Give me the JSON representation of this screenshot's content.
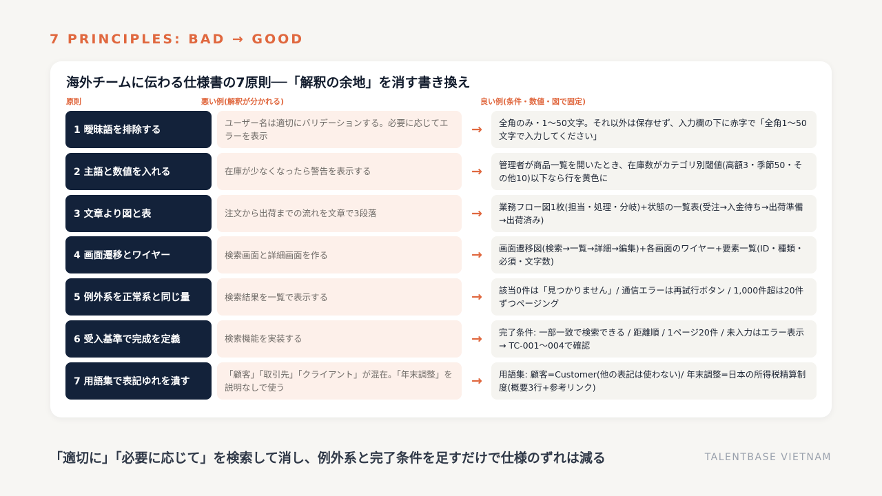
{
  "eyebrow": "7 PRINCIPLES: BAD → GOOD",
  "card": {
    "title": "海外チームに伝わる仕様書の7原則──「解釈の余地」を消す書き換え",
    "col_principle": "原則",
    "col_bad": "悪い例(解釈が分かれる)",
    "col_good": "良い例(条件・数値・図で固定)"
  },
  "rows": [
    {
      "principle": "1 曖昧語を排除する",
      "bad": "ユーザー名は適切にバリデーションする。必要に応じてエラーを表示",
      "arrow": "→",
      "good": "全角のみ・1〜50文字。それ以外は保存せず、入力欄の下に赤字で「全角1〜50文字で入力してください」"
    },
    {
      "principle": "2 主語と数値を入れる",
      "bad": "在庫が少なくなったら警告を表示する",
      "arrow": "→",
      "good": "管理者が商品一覧を開いたとき、在庫数がカテゴリ別閾値(高額3・季節50・その他10)以下なら行を黄色に"
    },
    {
      "principle": "3 文章より図と表",
      "bad": "注文から出荷までの流れを文章で3段落",
      "arrow": "→",
      "good": "業務フロー図1枚(担当・処理・分岐)+状態の一覧表(受注→入金待ち→出荷準備→出荷済み)"
    },
    {
      "principle": "4 画面遷移とワイヤー",
      "bad": "検索画面と詳細画面を作る",
      "arrow": "→",
      "good": "画面遷移図(検索→一覧→詳細→編集)+各画面のワイヤー+要素一覧(ID・種類・必須・文字数)"
    },
    {
      "principle": "5 例外系を正常系と同じ量",
      "bad": "検索結果を一覧で表示する",
      "arrow": "→",
      "good": "該当0件は「見つかりません」/ 通信エラーは再試行ボタン / 1,000件超は20件ずつページング"
    },
    {
      "principle": "6 受入基準で完成を定義",
      "bad": "検索機能を実装する",
      "arrow": "→",
      "good": "完了条件: 一部一致で検索できる / 距離順 / 1ページ20件 / 未入力はエラー表示 → TC-001〜004で確認"
    },
    {
      "principle": "7 用語集で表記ゆれを潰す",
      "bad": "「顧客」「取引先」「クライアント」が混在。「年末調整」を説明なしで使う",
      "arrow": "→",
      "good": "用語集: 顧客=Customer(他の表記は使わない)/ 年末調整=日本の所得税精算制度(概要3行+参考リンク)"
    }
  ],
  "footer": "「適切に」「必要に応じて」を検索して消し、例外系と完了条件を足すだけで仕様のずれは減る",
  "brand": "TALENTBASE VIETNAM",
  "colors": {
    "accent": "#e0683f",
    "navy": "#13223a",
    "bad_bg": "#fdf0ea",
    "good_bg": "#f5f4f0"
  }
}
